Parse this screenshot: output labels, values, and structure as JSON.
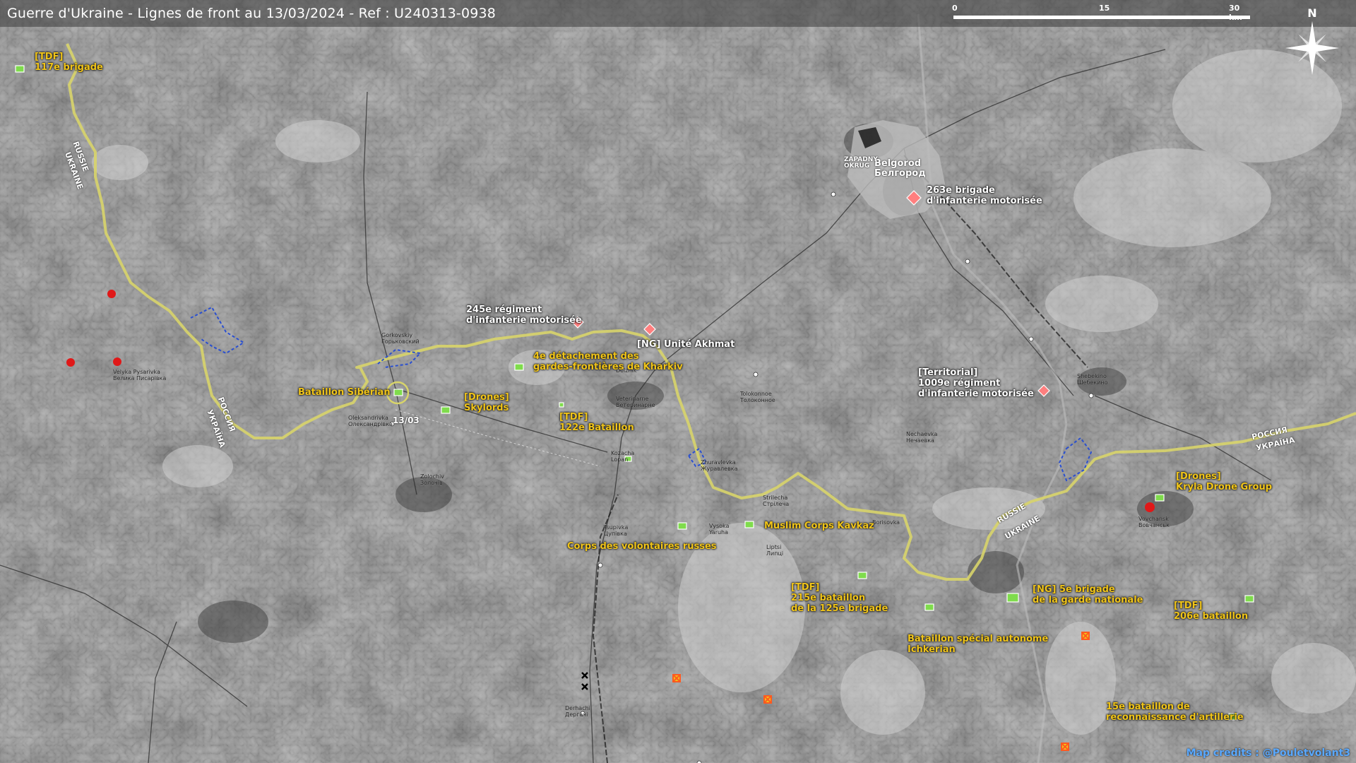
{
  "title": "Guerre d'Ukraine - Lignes de front au 13/03/2024 - Ref : U240313-0938",
  "scale": {
    "zero": "0",
    "mid": "15",
    "end": "30 km"
  },
  "compass": {
    "north_label": "N",
    "icon": "compass-rose-icon"
  },
  "credits": "Map credits : @Pouletvolant3",
  "frontline_date": "13/03",
  "colors": {
    "frontline": "#d8d46a",
    "unit_label": "#f0c419",
    "ukraine_marker": "#7fdc4c",
    "russian_marker": "#ff7f7f",
    "red_dot": "#e01818",
    "salient": "#2a4fd0",
    "credits": "#5aa9ff"
  },
  "units": [
    {
      "id": "tdf-117",
      "line1": "[TDF]",
      "line2": "117e brigade",
      "side": "ukraine"
    },
    {
      "id": "bataillon-siberian",
      "line1": "Bataillon Sibérian",
      "line2": "",
      "side": "ukraine"
    },
    {
      "id": "drones-skylords",
      "line1": "[Drones]",
      "line2": "Skylords",
      "side": "ukraine"
    },
    {
      "id": "245e-regiment",
      "line1": "245e régiment",
      "line2": "d'infanterie motorisée",
      "side": "russia"
    },
    {
      "id": "4e-detachement",
      "line1": "4e détachement des",
      "line2": "gardes-frontières de Kharkiv",
      "side": "ukraine"
    },
    {
      "id": "ng-akhmat",
      "line1": "[NG] Unité Akhmat",
      "line2": "",
      "side": "russia"
    },
    {
      "id": "tdf-122",
      "line1": "[TDF]",
      "line2": "122e Bataillon",
      "side": "ukraine"
    },
    {
      "id": "263e-brigade",
      "line1": "263e brigade",
      "line2": "d'infanterie motorisée",
      "side": "russia"
    },
    {
      "id": "territorial-1009",
      "line1": "[Territorial]",
      "line2": "1009e régiment",
      "line3": "d'infanterie motorisée",
      "side": "russia"
    },
    {
      "id": "drones-kryla",
      "line1": "[Drones]",
      "line2": "Kryla Drone Group",
      "side": "ukraine"
    },
    {
      "id": "muslim-corps",
      "line1": "Muslim Corps Kavkaz",
      "line2": "",
      "side": "ukraine"
    },
    {
      "id": "corps-volontaires",
      "line1": "Corps des volontaires russes",
      "line2": "",
      "side": "ukraine"
    },
    {
      "id": "tdf-215",
      "line1": "[TDF]",
      "line2": "215e bataillon",
      "line3": "de la 125e brigade",
      "side": "ukraine"
    },
    {
      "id": "ng-5e",
      "line1": "[NG] 5e brigade",
      "line2": "de la garde nationale",
      "side": "ukraine"
    },
    {
      "id": "tdf-206",
      "line1": "[TDF]",
      "line2": "206e bataillon",
      "side": "ukraine"
    },
    {
      "id": "bataillon-ichkerian",
      "line1": "Bataillon spécial autonome",
      "line2": "Ichkerian",
      "side": "ukraine"
    },
    {
      "id": "15e-bataillon",
      "line1": "15e bataillon de",
      "line2": "reconnaissance d'artillerie",
      "side": "ukraine"
    }
  ],
  "places": [
    {
      "id": "belgorod",
      "text": "Belgorod",
      "text2": "Белгород"
    },
    {
      "id": "zapadny",
      "text": "ZAPADNY",
      "text2": "OKRUG"
    },
    {
      "id": "vovchansk",
      "text": "Vovchansk",
      "text2": "Вовчанськ"
    },
    {
      "id": "kozacha-lopan",
      "text": "Kozacha",
      "text2": "Lopan"
    },
    {
      "id": "zolochiv",
      "text": "Zolochiv",
      "text2": "Золочів"
    },
    {
      "id": "dergachi",
      "text": "Derhachi",
      "text2": "Дергачі"
    },
    {
      "id": "vysoka-yaruha",
      "text": "Vysoka",
      "text2": "Yaruha"
    },
    {
      "id": "strilecha",
      "text": "Strilecha",
      "text2": "Стрілеча"
    },
    {
      "id": "lyptsi",
      "text": "Liptsi",
      "text2": "Липці"
    },
    {
      "id": "shebekino",
      "text": "Shebekino",
      "text2": "Шебекино"
    },
    {
      "id": "bolshaya-pisarevka",
      "text": "Velyka Pysarivka",
      "text2": "Велика Писарівка"
    },
    {
      "id": "dolzhik",
      "text": "Dolzhik",
      "text2": ""
    },
    {
      "id": "oleksandrivka",
      "text": "Oleksandrivka",
      "text2": "Олександрівка"
    },
    {
      "id": "nechaevka",
      "text": "Nechaevka",
      "text2": "Нечаевка"
    },
    {
      "id": "tsupivka",
      "text": "Tsupivka",
      "text2": "Цупівка"
    },
    {
      "id": "veterinarne",
      "text": "Veterinarne",
      "text2": "Ветеринарне"
    },
    {
      "id": "zhuravlevka",
      "text": "Zhuravlevka",
      "text2": "Журавлевка"
    },
    {
      "id": "tolokonnoe",
      "text": "Tolokonnoe",
      "text2": "Толоконное"
    },
    {
      "id": "borisovka",
      "text": "Borisovka",
      "text2": ""
    },
    {
      "id": "gorkovskiy",
      "text": "Gorkovskiy",
      "text2": "Горьковский"
    }
  ],
  "countries": [
    {
      "id": "russie-nw",
      "text": "RUSSIE"
    },
    {
      "id": "ukraine-nw",
      "text": "UKRAINE"
    },
    {
      "id": "russia-cyr-w",
      "text": "РОССИЯ"
    },
    {
      "id": "ukraina-cyr-w",
      "text": "УКРАЇНА"
    },
    {
      "id": "russie-e",
      "text": "RUSSIE"
    },
    {
      "id": "ukraine-e",
      "text": "UKRAINE"
    },
    {
      "id": "russia-cyr-e",
      "text": "РОССИЯ"
    },
    {
      "id": "ukraina-cyr-e",
      "text": "УКРАЇНА"
    }
  ]
}
